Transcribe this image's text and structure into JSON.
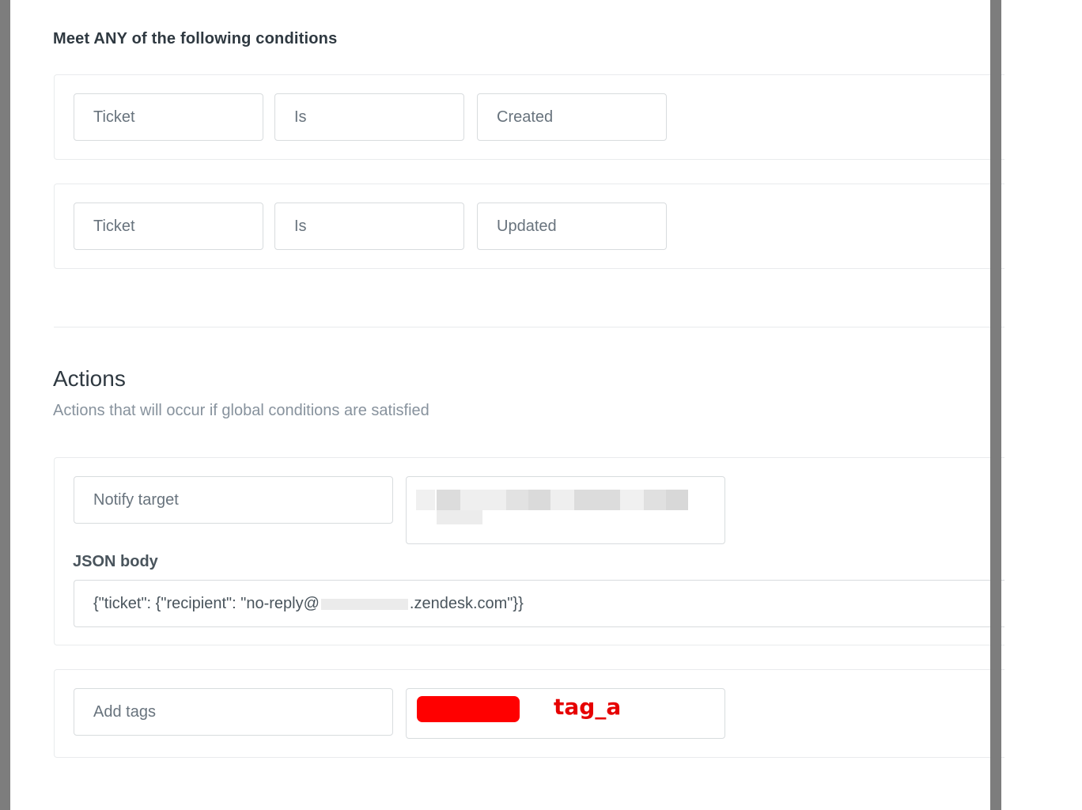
{
  "conditions": {
    "heading": "Meet ANY of the following conditions",
    "rows": [
      {
        "field": "Ticket",
        "operator": "Is",
        "value": "Created"
      },
      {
        "field": "Ticket",
        "operator": "Is",
        "value": "Updated"
      }
    ]
  },
  "actions": {
    "title": "Actions",
    "description": "Actions that will occur if global conditions are satisfied",
    "notify": {
      "action": "Notify target",
      "json_label": "JSON body",
      "json_prefix": "{\"ticket\": {\"recipient\": \"no-reply@",
      "json_suffix": ".zendesk.com\"}}"
    },
    "tags": {
      "action": "Add tags",
      "tag_value": "tag_a"
    }
  },
  "colors": {
    "redaction": "#ff0000",
    "tag_text": "#e60000",
    "border": "#d8dcde"
  }
}
